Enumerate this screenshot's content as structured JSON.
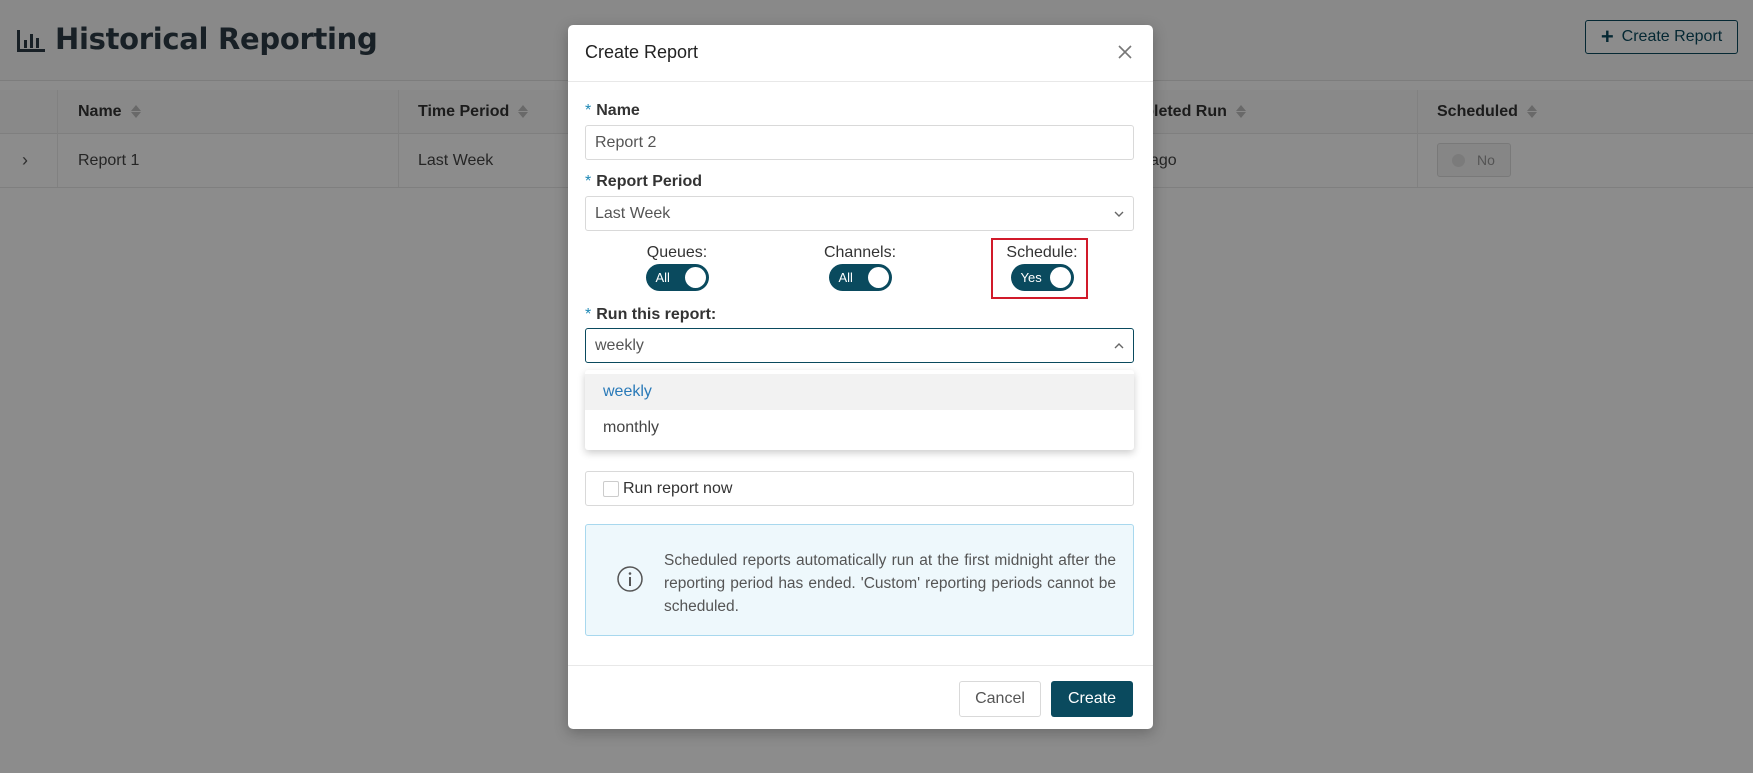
{
  "page": {
    "title": "Historical Reporting",
    "create_button_label": "Create Report",
    "columns": [
      "Name",
      "Time Period",
      "mpleted Run",
      "Scheduled"
    ],
    "rows": [
      {
        "name": "Report 1",
        "time_period": "Last Week",
        "last_run": "ago",
        "scheduled": "No"
      }
    ]
  },
  "modal": {
    "title": "Create Report",
    "name_label": "Name",
    "name_value": "Report 2",
    "period_label": "Report Period",
    "period_value": "Last Week",
    "toggles": [
      {
        "label": "Queues:",
        "value": "All"
      },
      {
        "label": "Channels:",
        "value": "All"
      },
      {
        "label": "Schedule:",
        "value": "Yes"
      }
    ],
    "run_label": "Run this report:",
    "run_value": "weekly",
    "run_options": [
      "weekly",
      "monthly"
    ],
    "run_now_label": "Run report now",
    "info_text": "Scheduled reports automatically run at the first midnight after the reporting period has ended. 'Custom' reporting periods cannot be scheduled.",
    "cancel_label": "Cancel",
    "create_label": "Create"
  },
  "colors": {
    "primary": "#0a4a5e",
    "highlight": "#d11a2a",
    "info_bg": "#eef8fc",
    "link": "#2a7ab8"
  },
  "icons": [
    "chart-bar-icon",
    "plus-icon",
    "sort-icon",
    "chevron-right-icon",
    "close-icon",
    "chevron-down-icon",
    "chevron-up-icon",
    "info-icon"
  ]
}
